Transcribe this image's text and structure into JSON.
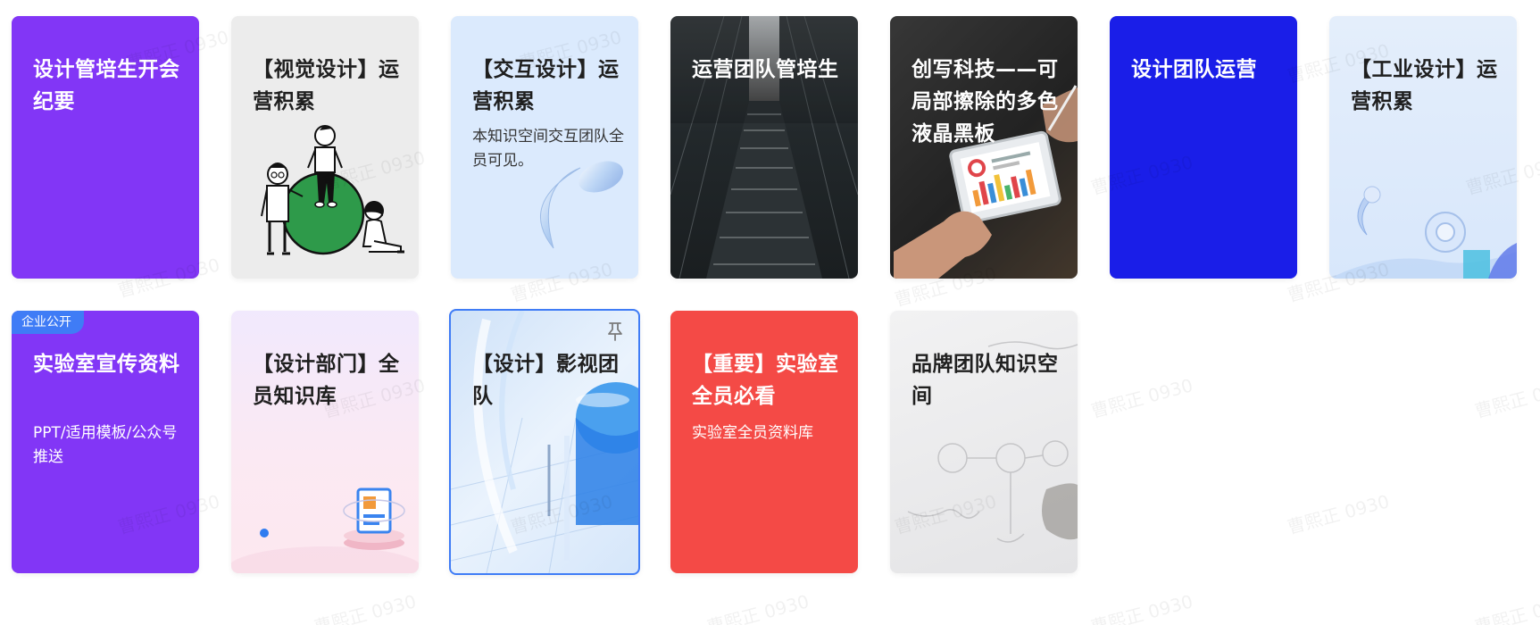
{
  "cards": [
    {
      "title": "设计管培生开会纪要",
      "desc": ""
    },
    {
      "title": "【视觉设计】运营积累",
      "desc": ""
    },
    {
      "title": "【交互设计】运营积累",
      "desc": "本知识空间交互团队全员可见。"
    },
    {
      "title": "运营团队管培生",
      "desc": ""
    },
    {
      "title": "创写科技——可局部擦除的多色液晶黑板",
      "desc": ""
    },
    {
      "title": "设计团队运营",
      "desc": ""
    },
    {
      "title": "【工业设计】运营积累",
      "desc": ""
    },
    {
      "title": "实验室宣传资料",
      "desc": "PPT/适用模板/公众号推送",
      "badge": "企业公开"
    },
    {
      "title": "【设计部门】全员知识库",
      "desc": ""
    },
    {
      "title": "【设计】影视团队",
      "desc": ""
    },
    {
      "title": "【重要】实验室全员必看",
      "desc": "实验室全员资料库"
    },
    {
      "title": "品牌团队知识空间",
      "desc": ""
    }
  ],
  "watermark": "曹熙正 0930",
  "colors": {
    "purple": "#8236f6",
    "blue": "#1a1ee8",
    "red": "#f44a46",
    "light_blue": "#dbeafd",
    "gray": "#ececec",
    "badge": "#3f7cf6",
    "selected_border": "#3f7cf6"
  }
}
